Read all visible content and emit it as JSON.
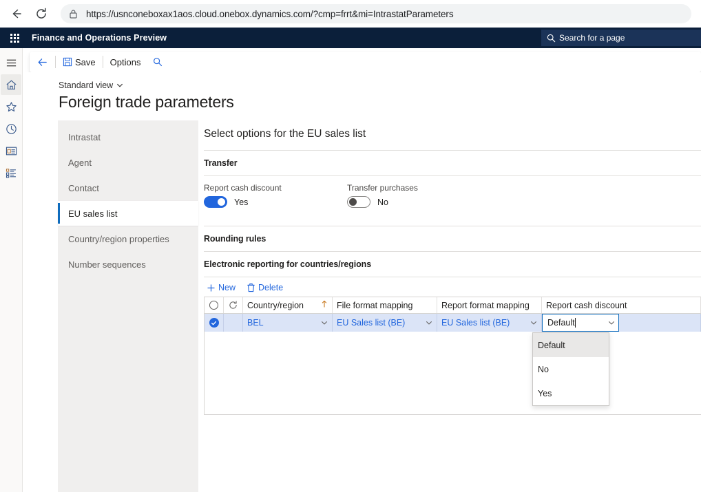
{
  "browser": {
    "url": "https://usnconeboxax1aos.cloud.onebox.dynamics.com/?cmp=frrt&mi=IntrastatParameters",
    "back_icon": "back-arrow-icon",
    "reload_icon": "reload-icon",
    "lock_icon": "lock-icon"
  },
  "appbar": {
    "waffle_icon": "app-launcher-icon",
    "title": "Finance and Operations Preview",
    "search_placeholder": "Search for a page",
    "search_icon": "search-icon",
    "bg_color": "#0b1f3a"
  },
  "rail": {
    "items": [
      {
        "icon": "hamburger-menu-icon",
        "name": "navigation-menu"
      },
      {
        "icon": "home-icon",
        "name": "home"
      },
      {
        "icon": "star-icon",
        "name": "favorites"
      },
      {
        "icon": "clock-icon",
        "name": "recent"
      },
      {
        "icon": "workspace-icon",
        "name": "workspaces"
      },
      {
        "icon": "list-icon",
        "name": "modules"
      }
    ]
  },
  "commandbar": {
    "back_icon": "back-arrow-icon",
    "save_label": "Save",
    "save_icon": "save-icon",
    "options_label": "Options",
    "search_icon": "search-icon"
  },
  "page": {
    "view_label": "Standard view",
    "view_chevron": "chevron-down-icon",
    "title": "Foreign trade parameters"
  },
  "tabs": {
    "items": [
      {
        "label": "Intrastat",
        "selected": false
      },
      {
        "label": "Agent",
        "selected": false
      },
      {
        "label": "Contact",
        "selected": false
      },
      {
        "label": "EU sales list",
        "selected": true
      },
      {
        "label": "Country/region properties",
        "selected": false
      },
      {
        "label": "Number sequences",
        "selected": false
      }
    ]
  },
  "main": {
    "heading": "Select options for the EU sales list",
    "sections": {
      "transfer": "Transfer",
      "rounding_rules": "Rounding rules",
      "electronic_reporting": "Electronic reporting for countries/regions"
    },
    "toggles": [
      {
        "label": "Report cash discount",
        "value": "Yes",
        "on": true
      },
      {
        "label": "Transfer purchases",
        "value": "No",
        "on": false
      }
    ],
    "grid_tools": {
      "new_label": "New",
      "new_icon": "plus-icon",
      "delete_label": "Delete",
      "delete_icon": "trash-icon"
    },
    "grid": {
      "select_all_icon": "select-all-circle-icon",
      "refresh_icon": "refresh-icon",
      "columns": [
        {
          "label": "Country/region",
          "sort": "ascending",
          "sort_icon": "sort-ascending-icon"
        },
        {
          "label": "File format mapping"
        },
        {
          "label": "Report format mapping"
        },
        {
          "label": "Report cash discount"
        }
      ],
      "rows": [
        {
          "selected": true,
          "country_region": "BEL",
          "file_format_mapping": "EU Sales list (BE)",
          "report_format_mapping": "EU Sales list (BE)",
          "report_cash_discount": "Default"
        }
      ]
    },
    "dropdown": {
      "open": true,
      "value": "Default",
      "chevron_icon": "chevron-down-icon",
      "options": [
        {
          "label": "Default",
          "highlighted": true
        },
        {
          "label": "No",
          "highlighted": false
        },
        {
          "label": "Yes",
          "highlighted": false
        }
      ]
    }
  },
  "colors": {
    "accent": "#2266dd",
    "navy": "#0b1f3a",
    "selected_row": "#dbe4f7",
    "tab_panel": "#f0efee"
  }
}
